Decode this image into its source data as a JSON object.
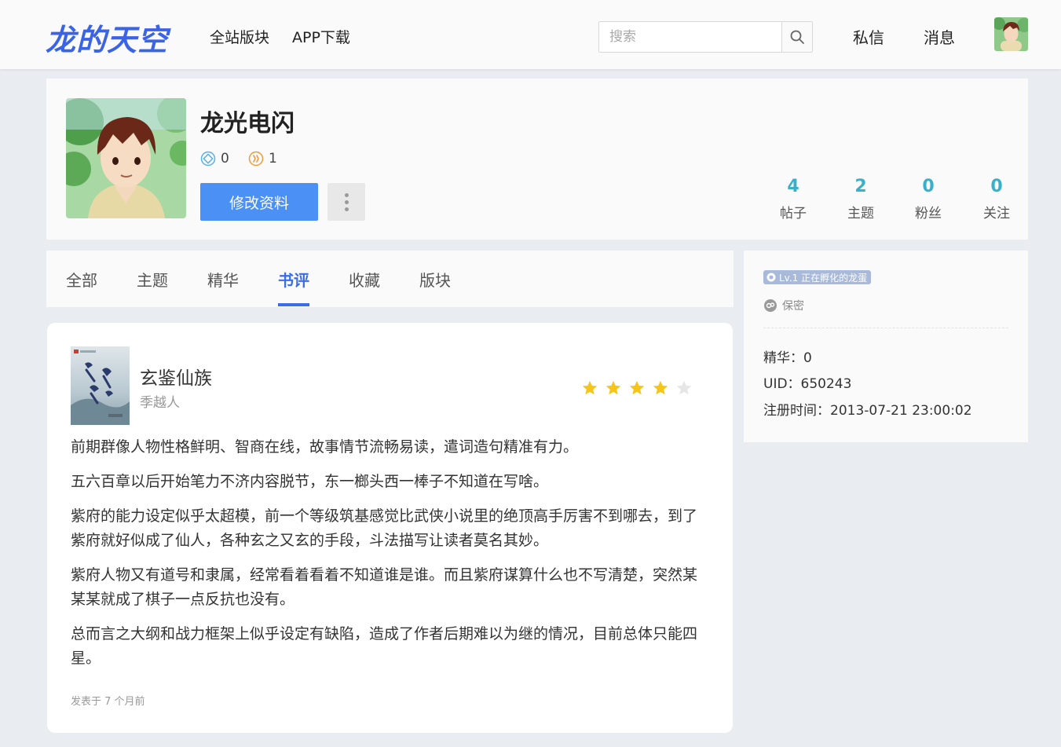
{
  "header": {
    "logo": "龙的天空",
    "nav": [
      {
        "label": "全站版块"
      },
      {
        "label": "APP下载"
      }
    ],
    "search_placeholder": "搜索",
    "search_icon": "search-icon",
    "dm_label": "私信",
    "msg_label": "消息"
  },
  "profile": {
    "username": "龙光电闪",
    "badge1_value": "0",
    "badge2_value": "1",
    "edit_label": "修改资料",
    "stats": [
      {
        "value": "4",
        "label": "帖子"
      },
      {
        "value": "2",
        "label": "主题"
      },
      {
        "value": "0",
        "label": "粉丝"
      },
      {
        "value": "0",
        "label": "关注"
      }
    ]
  },
  "tabs": [
    {
      "label": "全部"
    },
    {
      "label": "主题"
    },
    {
      "label": "精华"
    },
    {
      "label": "书评",
      "active": true
    },
    {
      "label": "收藏"
    },
    {
      "label": "版块"
    }
  ],
  "sidebar": {
    "level": "Lv.1 正在孵化的龙蛋",
    "gender": "保密",
    "rows": [
      {
        "text": "精华：0"
      },
      {
        "text": "UID：650243"
      },
      {
        "text": "注册时间：2013-07-21 23:00:02"
      }
    ]
  },
  "review": {
    "book_title": "玄鉴仙族",
    "author": "季越人",
    "rating": 4,
    "max_rating": 5,
    "paragraphs": [
      "前期群像人物性格鲜明、智商在线，故事情节流畅易读，遣词造句精准有力。",
      "五六百章以后开始笔力不济内容脱节，东一榔头西一棒子不知道在写啥。",
      "紫府的能力设定似乎太超模，前一个等级筑基感觉比武侠小说里的绝顶高手厉害不到哪去，到了紫府就好似成了仙人，各种玄之又玄的手段，斗法描写让读者莫名其妙。",
      "紫府人物又有道号和隶属，经常看着看着不知道谁是谁。而且紫府谋算什么也不写清楚，突然某某某就成了棋子一点反抗也没有。",
      "总而言之大纲和战力框架上似乎设定有缺陷，造成了作者后期难以为继的情况，目前总体只能四星。"
    ],
    "posted": "发表于 7 个月前"
  },
  "colors": {
    "accent": "#3b6ce8",
    "button": "#4a90f5",
    "stat": "#3ab0c8",
    "star_on": "#f5c518",
    "star_off": "#e6e6e6"
  }
}
